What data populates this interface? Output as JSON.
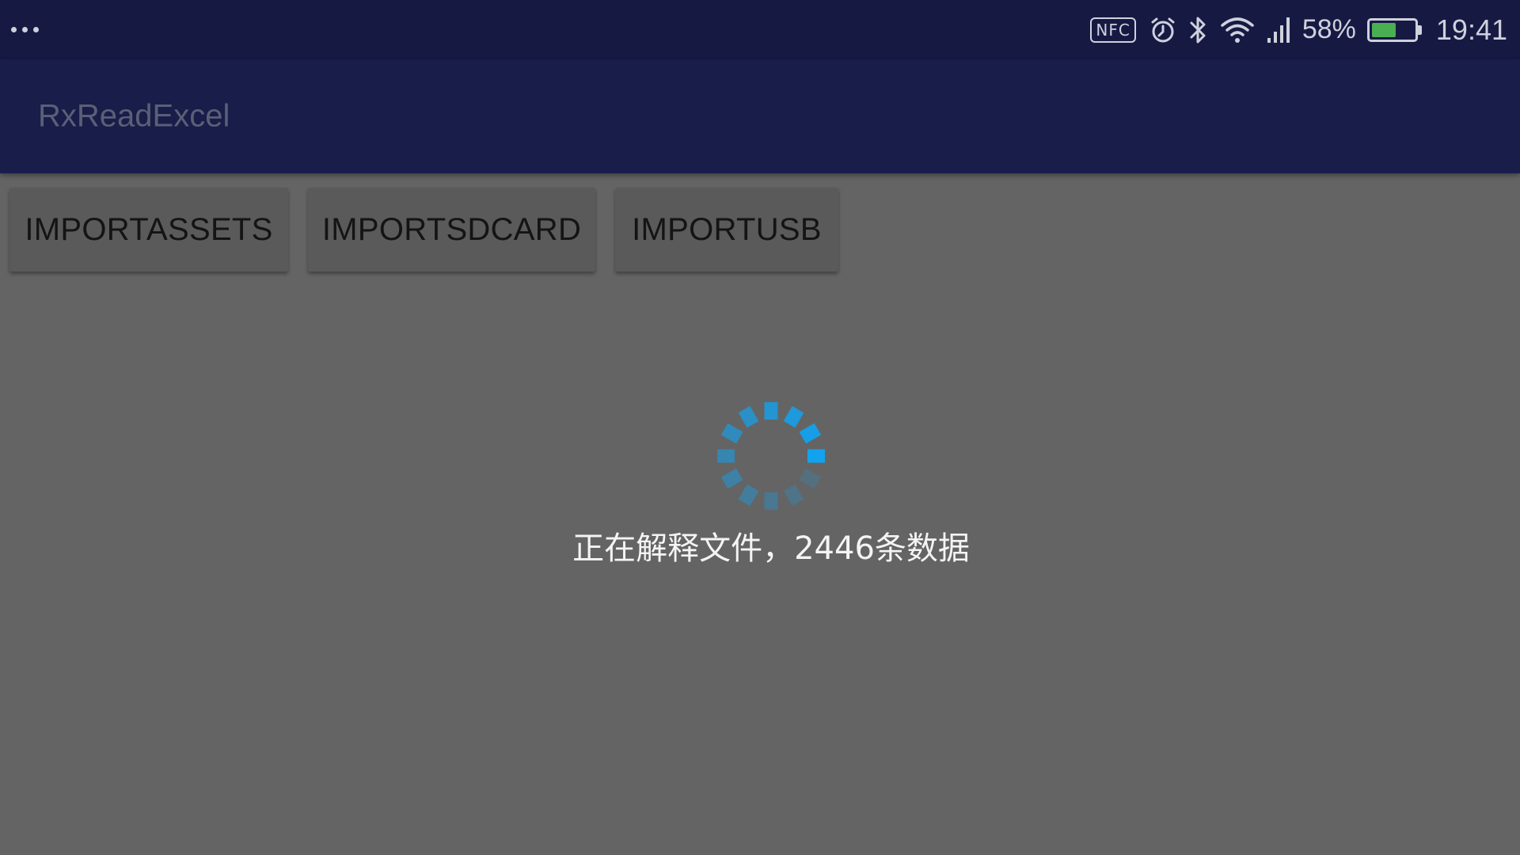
{
  "status_bar": {
    "menu_icon": "more-dots-icon",
    "nfc_label": "NFC",
    "icons": [
      "alarm-clock-icon",
      "bluetooth-icon",
      "wifi-icon",
      "cellular-signal-icon",
      "battery-icon"
    ],
    "battery_percent": "58%",
    "battery_level": 0.58,
    "time": "19:41"
  },
  "app_bar": {
    "title": "RxReadExcel"
  },
  "buttons": {
    "import_assets": "IMPORTASSETS",
    "import_sdcard": "IMPORTSDCARD",
    "import_usb": "IMPORTUSB"
  },
  "loading": {
    "spinner_icon": "loading-spinner-icon",
    "message": "正在解释文件，2446条数据"
  },
  "colors": {
    "status_bar_bg": "#161a43",
    "app_bar_bg": "#181d4a",
    "content_bg": "#646464",
    "spinner_accent": "#12a3f0",
    "battery_fill": "#4cae52"
  }
}
